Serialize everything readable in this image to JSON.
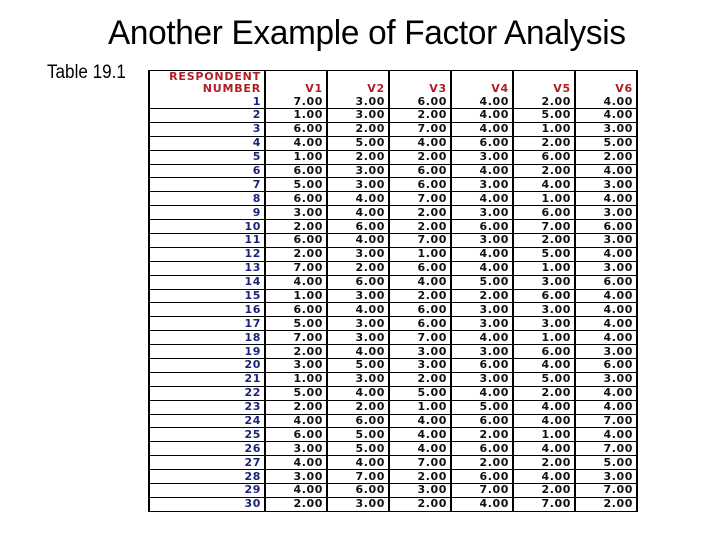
{
  "title": "Another Example of Factor Analysis",
  "caption": "Table 19.1",
  "table": {
    "header": {
      "respondent_line1": "RESPONDENT",
      "respondent_line2": "NUMBER",
      "columns": [
        "V1",
        "V2",
        "V3",
        "V4",
        "V5",
        "V6"
      ]
    },
    "colors": {
      "header_text": "#b01e23",
      "respondent_number_text": "#1a237e",
      "value_text": "#111111"
    },
    "rows": [
      {
        "n": "1",
        "v": [
          "7.00",
          "3.00",
          "6.00",
          "4.00",
          "2.00",
          "4.00"
        ]
      },
      {
        "n": "2",
        "v": [
          "1.00",
          "3.00",
          "2.00",
          "4.00",
          "5.00",
          "4.00"
        ]
      },
      {
        "n": "3",
        "v": [
          "6.00",
          "2.00",
          "7.00",
          "4.00",
          "1.00",
          "3.00"
        ]
      },
      {
        "n": "4",
        "v": [
          "4.00",
          "5.00",
          "4.00",
          "6.00",
          "2.00",
          "5.00"
        ]
      },
      {
        "n": "5",
        "v": [
          "1.00",
          "2.00",
          "2.00",
          "3.00",
          "6.00",
          "2.00"
        ]
      },
      {
        "n": "6",
        "v": [
          "6.00",
          "3.00",
          "6.00",
          "4.00",
          "2.00",
          "4.00"
        ]
      },
      {
        "n": "7",
        "v": [
          "5.00",
          "3.00",
          "6.00",
          "3.00",
          "4.00",
          "3.00"
        ]
      },
      {
        "n": "8",
        "v": [
          "6.00",
          "4.00",
          "7.00",
          "4.00",
          "1.00",
          "4.00"
        ]
      },
      {
        "n": "9",
        "v": [
          "3.00",
          "4.00",
          "2.00",
          "3.00",
          "6.00",
          "3.00"
        ]
      },
      {
        "n": "10",
        "v": [
          "2.00",
          "6.00",
          "2.00",
          "6.00",
          "7.00",
          "6.00"
        ]
      },
      {
        "n": "11",
        "v": [
          "6.00",
          "4.00",
          "7.00",
          "3.00",
          "2.00",
          "3.00"
        ]
      },
      {
        "n": "12",
        "v": [
          "2.00",
          "3.00",
          "1.00",
          "4.00",
          "5.00",
          "4.00"
        ]
      },
      {
        "n": "13",
        "v": [
          "7.00",
          "2.00",
          "6.00",
          "4.00",
          "1.00",
          "3.00"
        ]
      },
      {
        "n": "14",
        "v": [
          "4.00",
          "6.00",
          "4.00",
          "5.00",
          "3.00",
          "6.00"
        ]
      },
      {
        "n": "15",
        "v": [
          "1.00",
          "3.00",
          "2.00",
          "2.00",
          "6.00",
          "4.00"
        ]
      },
      {
        "n": "16",
        "v": [
          "6.00",
          "4.00",
          "6.00",
          "3.00",
          "3.00",
          "4.00"
        ]
      },
      {
        "n": "17",
        "v": [
          "5.00",
          "3.00",
          "6.00",
          "3.00",
          "3.00",
          "4.00"
        ]
      },
      {
        "n": "18",
        "v": [
          "7.00",
          "3.00",
          "7.00",
          "4.00",
          "1.00",
          "4.00"
        ]
      },
      {
        "n": "19",
        "v": [
          "2.00",
          "4.00",
          "3.00",
          "3.00",
          "6.00",
          "3.00"
        ]
      },
      {
        "n": "20",
        "v": [
          "3.00",
          "5.00",
          "3.00",
          "6.00",
          "4.00",
          "6.00"
        ]
      },
      {
        "n": "21",
        "v": [
          "1.00",
          "3.00",
          "2.00",
          "3.00",
          "5.00",
          "3.00"
        ]
      },
      {
        "n": "22",
        "v": [
          "5.00",
          "4.00",
          "5.00",
          "4.00",
          "2.00",
          "4.00"
        ]
      },
      {
        "n": "23",
        "v": [
          "2.00",
          "2.00",
          "1.00",
          "5.00",
          "4.00",
          "4.00"
        ]
      },
      {
        "n": "24",
        "v": [
          "4.00",
          "6.00",
          "4.00",
          "6.00",
          "4.00",
          "7.00"
        ]
      },
      {
        "n": "25",
        "v": [
          "6.00",
          "5.00",
          "4.00",
          "2.00",
          "1.00",
          "4.00"
        ]
      },
      {
        "n": "26",
        "v": [
          "3.00",
          "5.00",
          "4.00",
          "6.00",
          "4.00",
          "7.00"
        ]
      },
      {
        "n": "27",
        "v": [
          "4.00",
          "4.00",
          "7.00",
          "2.00",
          "2.00",
          "5.00"
        ]
      },
      {
        "n": "28",
        "v": [
          "3.00",
          "7.00",
          "2.00",
          "6.00",
          "4.00",
          "3.00"
        ]
      },
      {
        "n": "29",
        "v": [
          "4.00",
          "6.00",
          "3.00",
          "7.00",
          "2.00",
          "7.00"
        ]
      },
      {
        "n": "30",
        "v": [
          "2.00",
          "3.00",
          "2.00",
          "4.00",
          "7.00",
          "2.00"
        ]
      }
    ]
  }
}
